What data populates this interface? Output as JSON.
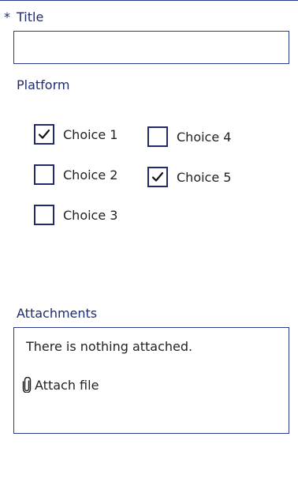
{
  "form": {
    "title": {
      "required_marker": "*",
      "label": "Title",
      "value": "",
      "placeholder": ""
    },
    "platform": {
      "label": "Platform",
      "choices": [
        {
          "label": "Choice 1",
          "checked": true
        },
        {
          "label": "Choice 2",
          "checked": false
        },
        {
          "label": "Choice 3",
          "checked": false
        },
        {
          "label": "Choice 4",
          "checked": false
        },
        {
          "label": "Choice 5",
          "checked": true
        }
      ]
    },
    "attachments": {
      "label": "Attachments",
      "empty_text": "There is nothing attached.",
      "attach_label": "Attach file",
      "attach_icon": "paperclip-icon"
    }
  },
  "colors": {
    "accent": "#1f2b6b",
    "border": "#2d3a8c",
    "text": "#222222"
  }
}
